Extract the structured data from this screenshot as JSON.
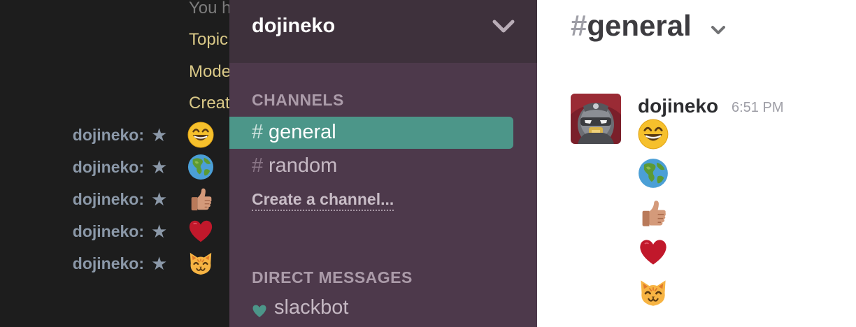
{
  "irc": {
    "system_lines": [
      "You h",
      "Topic",
      "Mode",
      "Creat"
    ],
    "messages": [
      {
        "nick": "dojineko:",
        "emoji": "smile-emoji"
      },
      {
        "nick": "dojineko:",
        "emoji": "earth-emoji"
      },
      {
        "nick": "dojineko:",
        "emoji": "thumbsup-emoji"
      },
      {
        "nick": "dojineko:",
        "emoji": "heart-emoji"
      },
      {
        "nick": "dojineko:",
        "emoji": "cat-emoji"
      }
    ],
    "colors": {
      "system_grey": "#7c7c7c",
      "system_yellow": "#d9c887",
      "nick": "#8b98a8"
    }
  },
  "sidebar": {
    "team_name": "dojineko",
    "channels_title": "CHANNELS",
    "channels": [
      {
        "hash": "#",
        "name": "general",
        "active": true
      },
      {
        "hash": "#",
        "name": "random",
        "active": false
      }
    ],
    "create_channel": "Create a channel...",
    "dm_title": "DIRECT MESSAGES",
    "direct_messages": [
      {
        "name": "slackbot",
        "icon": "heart-icon"
      }
    ],
    "colors": {
      "background": "#4d394b",
      "header": "#3e313c",
      "active": "#4c9689"
    }
  },
  "main": {
    "channel_hash": "#",
    "channel_name": "general",
    "message": {
      "author": "dojineko",
      "time": "6:51 PM",
      "emojis": [
        "smile-emoji",
        "earth-emoji",
        "thumbsup-emoji",
        "heart-emoji",
        "cat-emoji"
      ]
    }
  }
}
